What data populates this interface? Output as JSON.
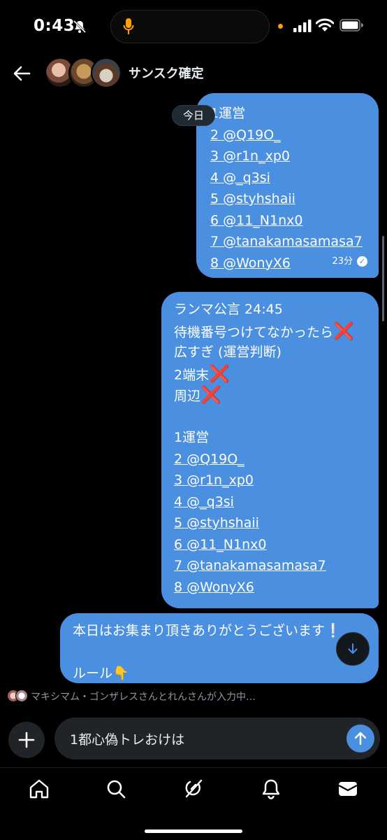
{
  "status_bar": {
    "time": "0:43"
  },
  "header": {
    "title": "サンスク確定"
  },
  "date_separator": "今日",
  "messages": [
    {
      "lines": [
        "1運営",
        "2 @Q19O_",
        "3 @r1n_xp0",
        "4 @_q3si",
        "5 @styhshaii",
        "6 @11_N1nx0",
        "7 @tanakamasamasa7",
        "8 @WonyX6"
      ],
      "time": "23分"
    },
    {
      "lines": [
        "ランマ公言 24:45",
        "待機番号つけてなかったら",
        "広すぎ (運営判断)",
        "2端末",
        "周辺",
        "",
        "1運営",
        "2 @Q19O_",
        "3 @r1n_xp0",
        "4 @_q3si",
        "5 @styhshaii",
        "6 @11_N1nx0",
        "7 @tanakamasamasa7",
        "8 @WonyX6"
      ],
      "marks": [
        "❌",
        "❌",
        "❌"
      ]
    },
    {
      "lines": [
        "本日はお集まり頂きありがとうございます❕",
        "",
        "ルール👇"
      ]
    }
  ],
  "typing_indicator": "マキシマム・ゴンザレスさんとれんさんが入力中…",
  "composer": {
    "value": "1都心偽トレおけは"
  },
  "icons": {
    "back": "back-arrow-icon",
    "scroll_down": "arrow-down-icon",
    "plus": "plus-icon",
    "send": "arrow-up-icon",
    "nav": [
      "home-icon",
      "search-icon",
      "grok-icon",
      "bell-icon",
      "mail-icon"
    ]
  },
  "colors": {
    "bubble": "#4a8fe0",
    "background": "#000000",
    "unavailable_mark": "#e8344a"
  }
}
